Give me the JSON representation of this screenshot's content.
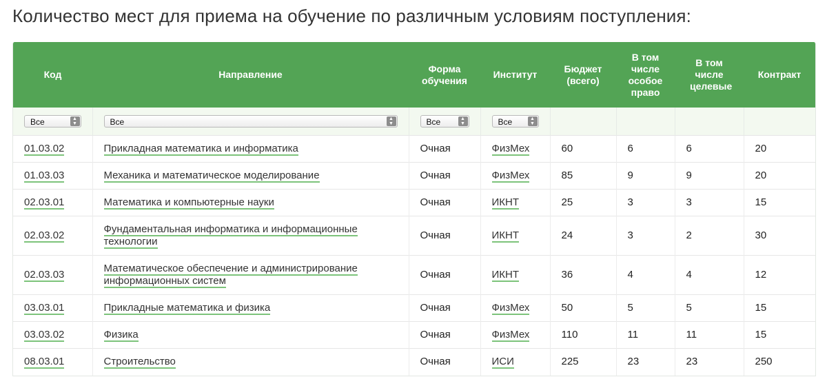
{
  "title": "Количество мест для приема на обучение по различным условиям поступления:",
  "columns": {
    "code": "Код",
    "direction": "Направление",
    "form": "Форма обучения",
    "institute": "Институт",
    "budget": "Бюджет (всего)",
    "special": "В том числе особое право",
    "target": "В том числе целевые",
    "contract": "Контракт"
  },
  "filters": {
    "code": "Все",
    "direction": "Все",
    "form": "Все",
    "institute": "Все"
  },
  "rows": [
    {
      "code": "01.03.02",
      "direction": "Прикладная математика и информатика",
      "form": "Очная",
      "institute": "ФизМех",
      "budget": "60",
      "special": "6",
      "target": "6",
      "contract": "20"
    },
    {
      "code": "01.03.03",
      "direction": "Механика и математическое моделирование",
      "form": "Очная",
      "institute": "ФизМех",
      "budget": "85",
      "special": "9",
      "target": "9",
      "contract": "20"
    },
    {
      "code": "02.03.01",
      "direction": "Математика и компьютерные науки",
      "form": "Очная",
      "institute": "ИКНТ",
      "budget": "25",
      "special": "3",
      "target": "3",
      "contract": "15"
    },
    {
      "code": "02.03.02",
      "direction": "Фундаментальная информатика и информационные технологии",
      "form": "Очная",
      "institute": "ИКНТ",
      "budget": "24",
      "special": "3",
      "target": "2",
      "contract": "30"
    },
    {
      "code": "02.03.03",
      "direction": "Математическое обеспечение и администрирование информационных систем",
      "form": "Очная",
      "institute": "ИКНТ",
      "budget": "36",
      "special": "4",
      "target": "4",
      "contract": "12"
    },
    {
      "code": "03.03.01",
      "direction": "Прикладные математика и физика",
      "form": "Очная",
      "institute": "ФизМех",
      "budget": "50",
      "special": "5",
      "target": "5",
      "contract": "15"
    },
    {
      "code": "03.03.02",
      "direction": "Физика",
      "form": "Очная",
      "institute": "ФизМех",
      "budget": "110",
      "special": "11",
      "target": "11",
      "contract": "15"
    },
    {
      "code": "08.03.01",
      "direction": "Строительство",
      "form": "Очная",
      "institute": "ИСИ",
      "budget": "225",
      "special": "23",
      "target": "23",
      "contract": "250"
    }
  ],
  "colors": {
    "header_bg": "#53a455",
    "filter_bg": "#f3f9f0",
    "link_underline": "#7cc37a"
  }
}
